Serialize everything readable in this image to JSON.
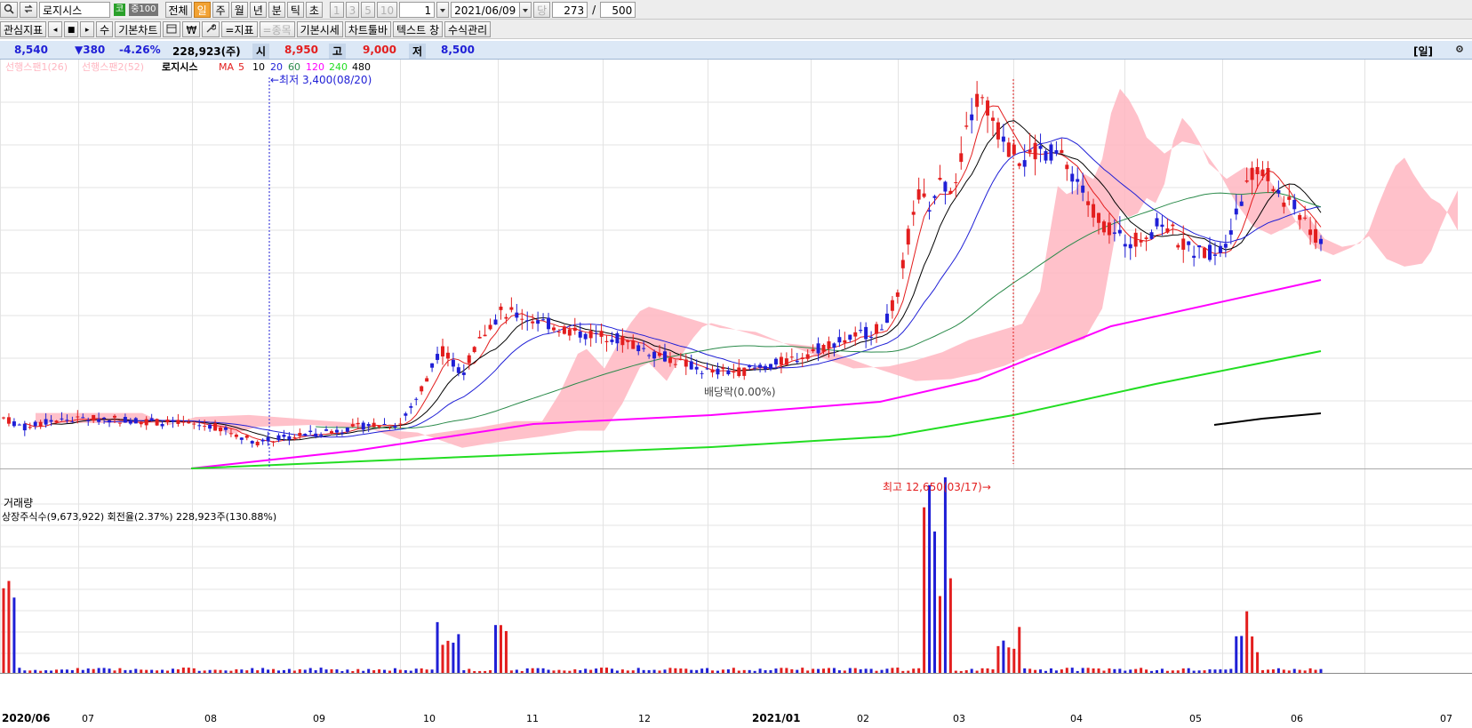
{
  "toolbar1": {
    "stock_name": "로지시스",
    "market_badge": "코",
    "index_badge": "중100",
    "period_buttons": [
      "전체",
      "일",
      "주",
      "월",
      "년",
      "분",
      "틱",
      "초"
    ],
    "active_period": "일",
    "interval_buttons": [
      "1",
      "3",
      "5",
      "10"
    ],
    "interval_value": "1",
    "date_value": "2021/06/09",
    "date_tag": "당",
    "count_value": "273",
    "count_sep": "/",
    "count_total": "500"
  },
  "toolbar2": {
    "buttons": [
      "관심지표",
      "◂",
      "■",
      "▸",
      "수",
      "기본차트",
      "₩",
      "=지표",
      "=종목",
      "기본시세",
      "차트툴바",
      "텍스트 창",
      "수식관리"
    ]
  },
  "infobar": {
    "price": "8,540",
    "change": "▼380",
    "change_pct": "-4.26%",
    "volume": "228,923(주)",
    "open_label": "시",
    "open_value": "8,950",
    "high_label": "고",
    "high_value": "9,000",
    "low_label": "저",
    "low_value": "8,500",
    "period_tag": "[일]"
  },
  "legend": {
    "span1": "선행스팬1(26)",
    "span2": "선행스팬2(52)",
    "stock": "로지시스",
    "ma_label": "MA",
    "ma_periods": [
      "5",
      "10",
      "20",
      "60",
      "120",
      "240",
      "480"
    ]
  },
  "annotations": {
    "low": "←최저 3,400(08/20)",
    "high": "최고 12,650(03/17)→",
    "dividend": "배당락(0.00%)"
  },
  "volume_panel": {
    "title": "거래량",
    "info": "상장주식수(9,673,922) 회전율(2.37%) 228,923주(130.88%)"
  },
  "x_axis": [
    "2020/06",
    "07",
    "08",
    "09",
    "10",
    "11",
    "12",
    "2021/01",
    "02",
    "03",
    "04",
    "05",
    "06",
    "07"
  ],
  "colors": {
    "up": "#e31e1e",
    "down": "#1f1fd6",
    "ma5": "#e31e1e",
    "ma10": "#000000",
    "ma20": "#1f1fd6",
    "ma60": "#2a8a4a",
    "ma120": "#ff00ff",
    "ma240": "#22dd22",
    "ma480": "#000000",
    "cloud": "#ffb6c1",
    "infobar_bg": "#dce8f6"
  },
  "chart_data": {
    "type": "candlestick",
    "price_range": [
      3000,
      13000
    ],
    "price_anchors": [
      {
        "date": "2020/06",
        "close": 4000
      },
      {
        "date": "2020/08/20",
        "low": 3400
      },
      {
        "date": "2020/10",
        "close": 5900
      },
      {
        "date": "2020/11",
        "close": 7000
      },
      {
        "date": "2021/01",
        "close": 4200
      },
      {
        "date": "2021/02",
        "close": 5000
      },
      {
        "date": "2021/03/17",
        "high": 12650
      },
      {
        "date": "2021/04",
        "close": 10500
      },
      {
        "date": "2021/05",
        "close": 8000
      },
      {
        "date": "2021/06/09",
        "open": 8950,
        "high": 9000,
        "low": 8500,
        "close": 8540
      }
    ],
    "moving_averages": [
      "5",
      "10",
      "20",
      "60",
      "120",
      "240",
      "480"
    ],
    "last_volume": 228923
  }
}
